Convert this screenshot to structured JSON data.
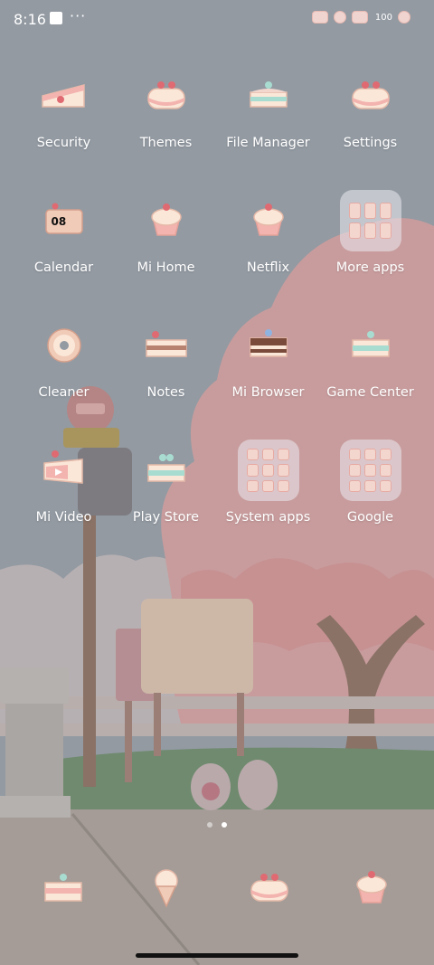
{
  "status_bar": {
    "time": "8:16",
    "more_notifications": "···",
    "battery": "100"
  },
  "apps": [
    {
      "label": "Security",
      "icon": "cake-slice-icon"
    },
    {
      "label": "Themes",
      "icon": "cherry-cake-icon"
    },
    {
      "label": "File Manager",
      "icon": "blueberry-cake-icon"
    },
    {
      "label": "Settings",
      "icon": "cherry-cake-icon"
    },
    {
      "label": "Calendar",
      "icon": "calendar-cake-icon",
      "date": "08"
    },
    {
      "label": "Mi Home",
      "icon": "cupcake-icon"
    },
    {
      "label": "Netflix",
      "icon": "cupcake-icon"
    },
    {
      "label": "More apps",
      "icon": "folder-icon"
    },
    {
      "label": "Cleaner",
      "icon": "donut-icon"
    },
    {
      "label": "Notes",
      "icon": "cake-slice-icon"
    },
    {
      "label": "Mi Browser",
      "icon": "chocolate-cake-icon"
    },
    {
      "label": "Game Center",
      "icon": "cake-slice-icon"
    },
    {
      "label": "Mi Video",
      "icon": "video-cake-icon"
    },
    {
      "label": "Play Store",
      "icon": "blueberry-cake-icon"
    },
    {
      "label": "System apps",
      "icon": "folder-icon"
    },
    {
      "label": "Google",
      "icon": "folder-icon"
    }
  ],
  "dock": [
    {
      "icon": "cake-slice-icon"
    },
    {
      "icon": "ice-cream-icon"
    },
    {
      "icon": "cherry-cake-icon"
    },
    {
      "icon": "cupcake-icon"
    }
  ],
  "pager": {
    "pages": 2,
    "active_page": 2
  },
  "colors": {
    "cream": "#fbe7d8",
    "pink": "#f3b3ae",
    "red": "#e06a72",
    "mint": "#a8dcd1",
    "brown": "#7a4b3a",
    "sky": "#939aa2",
    "tree_pink": "#c89c9d"
  }
}
